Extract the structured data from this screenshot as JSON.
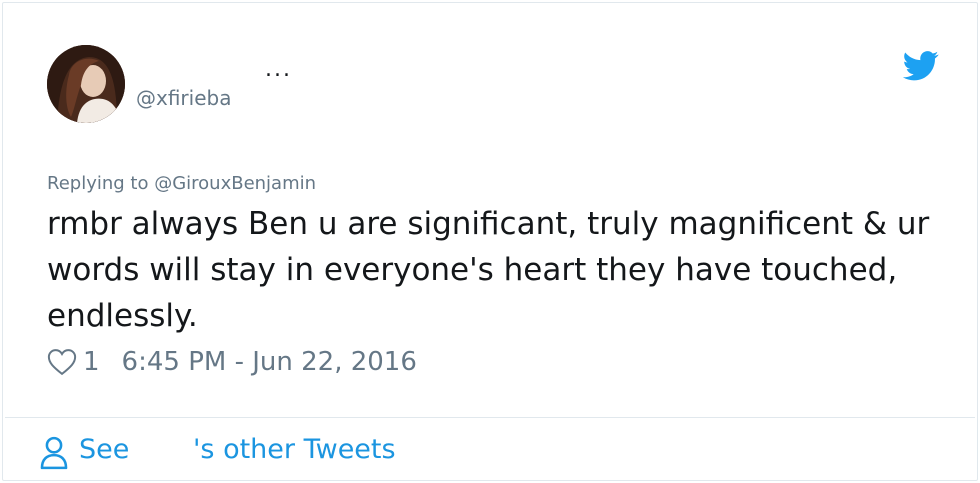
{
  "tweet": {
    "display_name": "...",
    "handle": "@xfirieba",
    "replying_to": "Replying to @GirouxBenjamin",
    "text": "rmbr always Ben u are significant, truly magnificent & ur words will stay in everyone's heart they have touched, endlessly.",
    "like_count": "1",
    "timestamp": "6:45 PM - Jun 22, 2016"
  },
  "footer": {
    "see_label": "See",
    "other_tweets_label": "'s other Tweets"
  },
  "colors": {
    "link_blue": "#1b95e0",
    "twitter_bird": "#1da1f2",
    "secondary_text": "#657786",
    "primary_text": "#14171a"
  },
  "icons": [
    "twitter-bird-icon",
    "heart-icon",
    "user-icon"
  ]
}
